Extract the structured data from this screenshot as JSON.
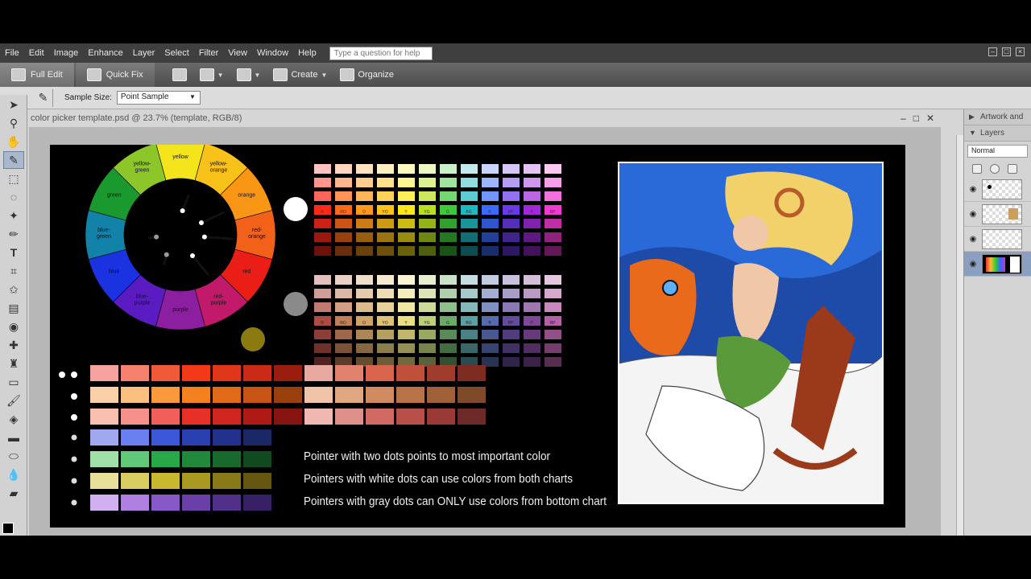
{
  "menu": [
    "File",
    "Edit",
    "Image",
    "Enhance",
    "Layer",
    "Select",
    "Filter",
    "View",
    "Window",
    "Help"
  ],
  "help_placeholder": "Type a question for help",
  "modes": {
    "full_edit": "Full Edit",
    "quick_fix": "Quick Fix",
    "create": "Create",
    "organize": "Organize"
  },
  "options": {
    "sample_label": "Sample Size:",
    "sample_value": "Point Sample"
  },
  "document": {
    "title": "color picker template.psd @ 23.7% (template, RGB/8)"
  },
  "panels": {
    "artwork": "Artwork and",
    "layers": "Layers",
    "blend_mode": "Normal"
  },
  "wheel": {
    "segments": [
      {
        "label": "yellow",
        "color": "#f4e41c"
      },
      {
        "label": "yellow-orange",
        "color": "#f9c21a"
      },
      {
        "label": "orange",
        "color": "#f99616"
      },
      {
        "label": "red-orange",
        "color": "#f2611a"
      },
      {
        "label": "red",
        "color": "#ea1e16"
      },
      {
        "label": "red-purple",
        "color": "#c21a6a"
      },
      {
        "label": "purple",
        "color": "#8c1ea0"
      },
      {
        "label": "blue-purple",
        "color": "#5a1cc0"
      },
      {
        "label": "blue",
        "color": "#1a32e0"
      },
      {
        "label": "blue-green",
        "color": "#1282a8"
      },
      {
        "label": "green",
        "color": "#1a9a2e"
      },
      {
        "label": "yellow-green",
        "color": "#8cc628"
      }
    ]
  },
  "legend": {
    "line1": "Pointer with two dots points to most important color",
    "line2": "Pointers with white dots can use colors from both charts",
    "line3": "Pointers with gray dots can ONLY use colors from bottom chart"
  },
  "top_chart_hues": [
    "#ff2a1a",
    "#ff6a1a",
    "#ff9a1a",
    "#ffc21a",
    "#ffe81a",
    "#b8e020",
    "#3ec83a",
    "#20b8c0",
    "#3a6aff",
    "#6a3ae8",
    "#a02ad8",
    "#f03ad0"
  ],
  "top_chart_codes": [
    "R",
    "RO",
    "O",
    "YO",
    "Y",
    "YG",
    "G",
    "BG",
    "B",
    "BP",
    "P",
    "RP"
  ],
  "skin_rows": [
    [
      "#f5a3a0",
      "#f5826e",
      "#f05a3a",
      "#f23a1a",
      "#e0361a",
      "#c82a16",
      "#9a1e10",
      "#e8aaa0",
      "#e0826e",
      "#d8644c",
      "#c0503c",
      "#a03c2c",
      "#7e2c22"
    ],
    [
      "#f9d0a8",
      "#f9c080",
      "#f99a3c",
      "#f58020",
      "#e06a18",
      "#c85514",
      "#9a400e",
      "#f0c4a8",
      "#e0a880",
      "#d08c60",
      "#b87448",
      "#a06038",
      "#7e4a2a"
    ],
    [
      "#f9c0b0",
      "#f5908a",
      "#f0605a",
      "#e83028",
      "#d0241e",
      "#b01a16",
      "#861410",
      "#f0b8b0",
      "#e0908a",
      "#d06a62",
      "#b8504a",
      "#9a3a36",
      "#6e2a28"
    ]
  ],
  "cool_rows": [
    [
      "#a0a8f0",
      "#6a80f0",
      "#3a58d8",
      "#2a40b0",
      "#22328a",
      "#1a2666"
    ],
    [
      "#a0e0a8",
      "#60c878",
      "#28a848",
      "#208838",
      "#186a2c",
      "#104a1e"
    ],
    [
      "#e8e09a",
      "#d8cc60",
      "#c8b830",
      "#a89a20",
      "#887a18",
      "#645810"
    ],
    [
      "#d0b0f0",
      "#b080e0",
      "#8858c8",
      "#6a40a8",
      "#503088",
      "#382066"
    ]
  ]
}
